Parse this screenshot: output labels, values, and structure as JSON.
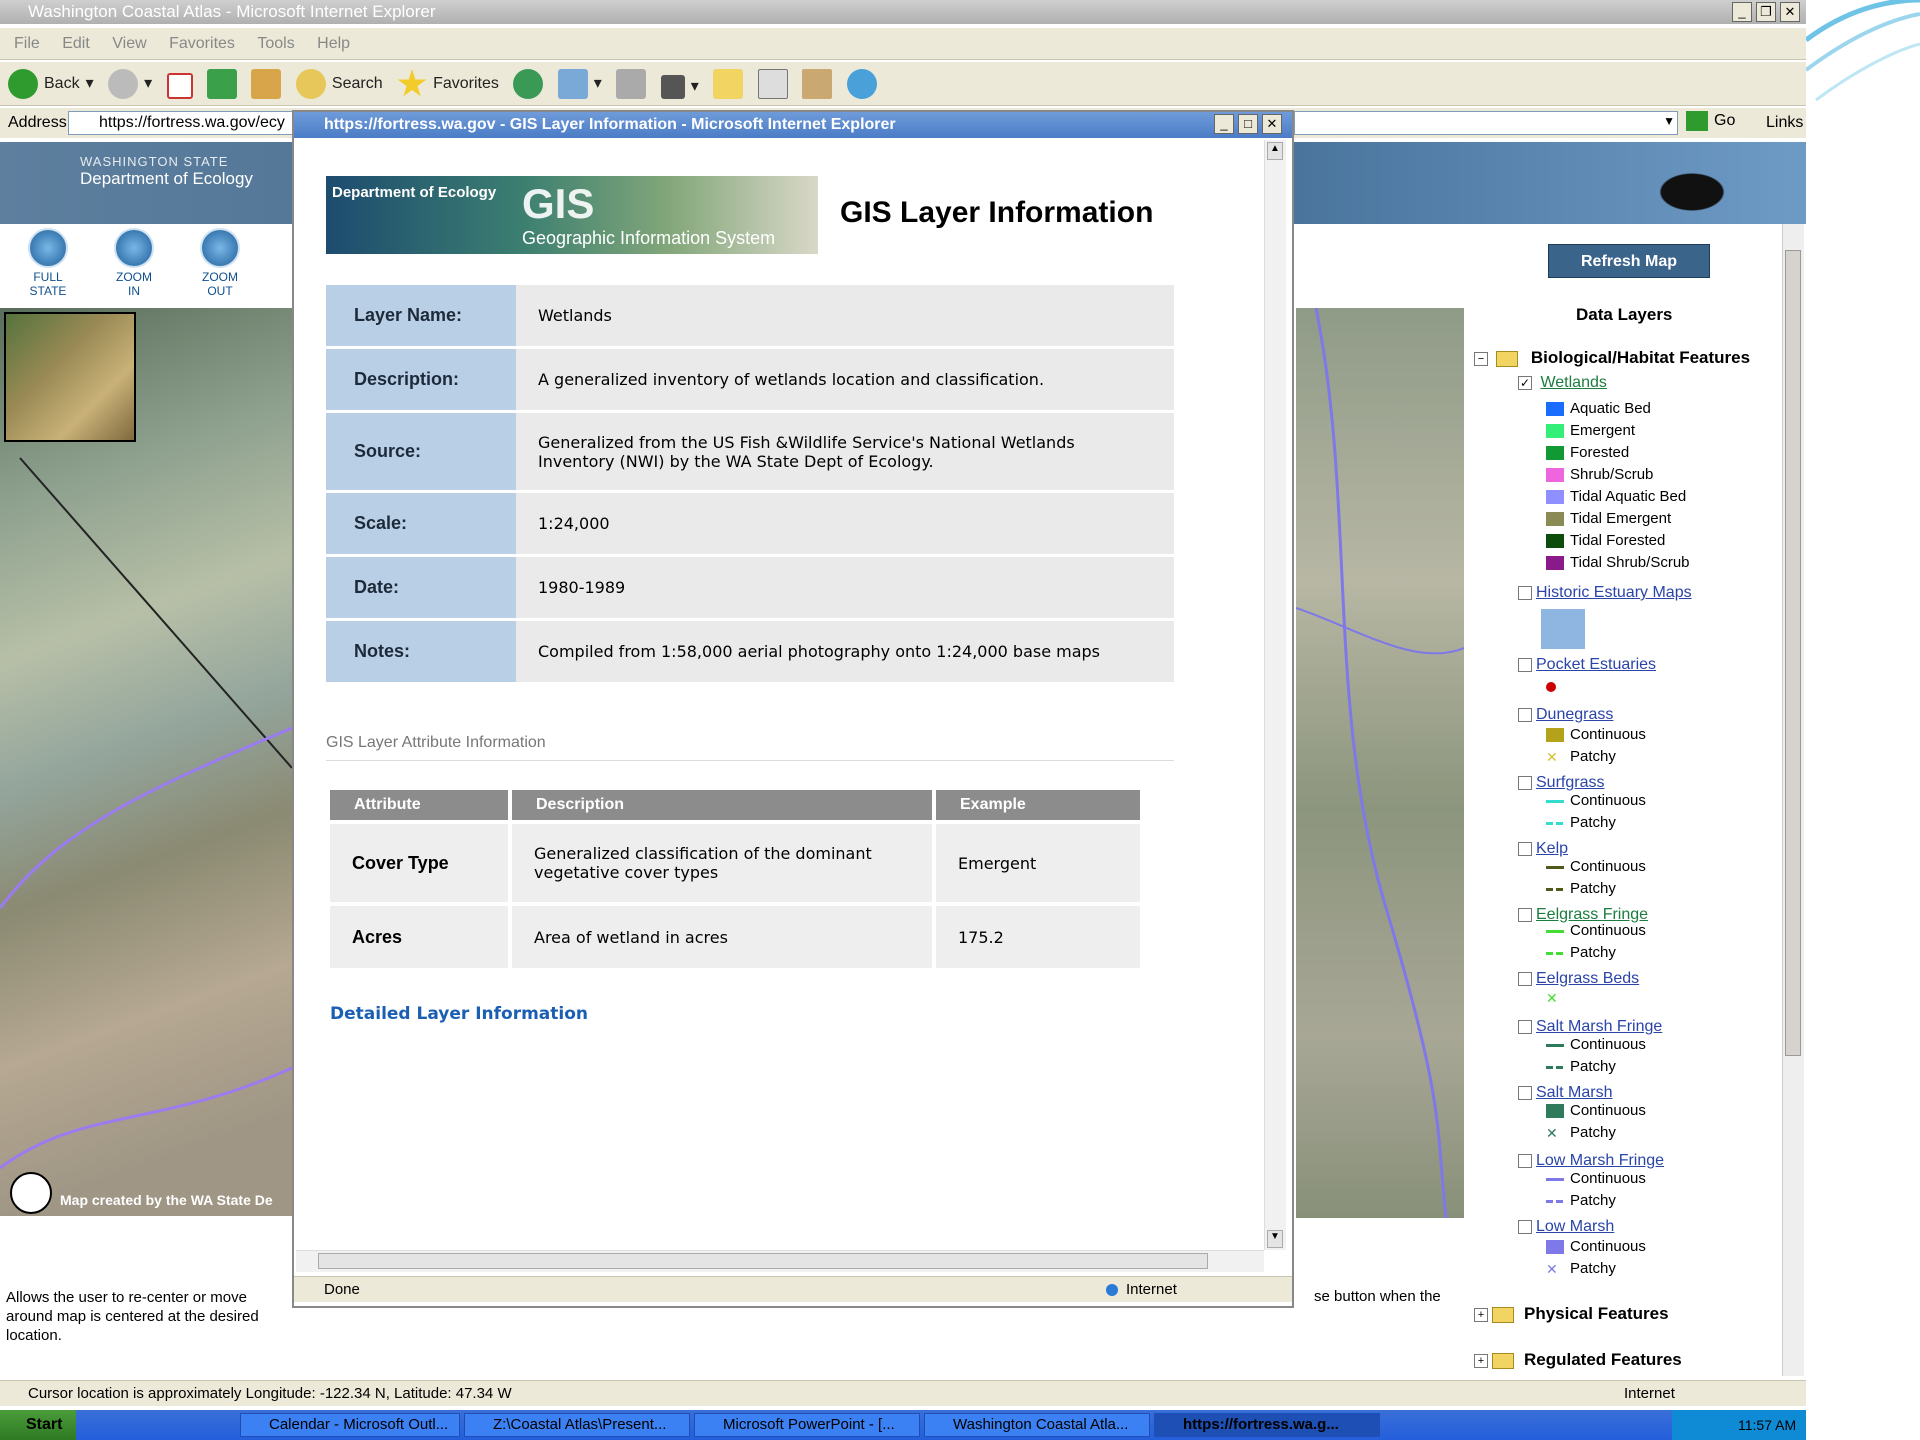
{
  "window": {
    "title": "Washington Coastal Atlas - Microsoft Internet Explorer"
  },
  "menu": [
    "File",
    "Edit",
    "View",
    "Favorites",
    "Tools",
    "Help"
  ],
  "toolbar": {
    "back": "Back",
    "search": "Search",
    "favorites": "Favorites"
  },
  "address": {
    "label": "Address",
    "value": "https://fortress.wa.gov/ecy",
    "go": "Go",
    "links": "Links"
  },
  "agency": {
    "line1": "WASHINGTON STATE",
    "line2": "Department of Ecology"
  },
  "map_tools": [
    {
      "label1": "FULL",
      "label2": "STATE"
    },
    {
      "label1": "ZOOM",
      "label2": "IN"
    },
    {
      "label1": "ZOOM",
      "label2": "OUT"
    }
  ],
  "map_credit": "Map created by the WA State De",
  "help_text_left": "Allows the user to re-center or move around map is centered at the desired location.",
  "help_text_right": "se button when the",
  "popup": {
    "title": "https://fortress.wa.gov - GIS Layer Information - Microsoft Internet Explorer",
    "banner_dept": "Department of Ecology",
    "banner_gis": "GIS",
    "banner_sub": "Geographic Information System",
    "heading": "GIS Layer Information",
    "info": [
      {
        "label": "Layer Name:",
        "value": "Wetlands"
      },
      {
        "label": "Description:",
        "value": "A generalized inventory of wetlands location and classification."
      },
      {
        "label": "Source:",
        "value": "Generalized from the US Fish &Wildlife Service's National Wetlands Inventory (NWI) by the WA State Dept of Ecology."
      },
      {
        "label": "Scale:",
        "value": "1:24,000"
      },
      {
        "label": "Date:",
        "value": "1980-1989"
      },
      {
        "label": "Notes:",
        "value": "Compiled from 1:58,000 aerial photography onto 1:24,000 base maps"
      }
    ],
    "attr_heading": "GIS Layer Attribute Information",
    "attr_columns": [
      "Attribute",
      "Description",
      "Example"
    ],
    "attr_rows": [
      {
        "name": "Cover Type",
        "desc": "Generalized classification of the dominant vegetative cover types",
        "example": "Emergent"
      },
      {
        "name": "Acres",
        "desc": "Area of wetland in acres",
        "example": "175.2"
      }
    ],
    "detail_link": "Detailed Layer Information",
    "status_done": "Done",
    "status_zone": "Internet"
  },
  "right_panel": {
    "refresh": "Refresh Map",
    "heading": "Data Layers",
    "group1": "Biological/Habitat Features",
    "wetlands": "Wetlands",
    "wetland_classes": [
      {
        "name": "Aquatic Bed",
        "color": "#1a6cff"
      },
      {
        "name": "Emergent",
        "color": "#33ee77"
      },
      {
        "name": "Forested",
        "color": "#119933"
      },
      {
        "name": "Shrub/Scrub",
        "color": "#ee66dd"
      },
      {
        "name": "Tidal Aquatic Bed",
        "color": "#8f8fff"
      },
      {
        "name": "Tidal Emergent",
        "color": "#8a8a55"
      },
      {
        "name": "Tidal Forested",
        "color": "#0c4d0c"
      },
      {
        "name": "Tidal Shrub/Scrub",
        "color": "#8a1a8a"
      }
    ],
    "historic": "Historic Estuary Maps",
    "pocket": "Pocket Estuaries",
    "dunegrass": "Dunegrass",
    "surfgrass": "Surfgrass",
    "kelp": "Kelp",
    "eelgrass_fringe": "Eelgrass Fringe",
    "eelgrass_beds": "Eelgrass Beds",
    "salt_marsh_fringe": "Salt Marsh Fringe",
    "salt_marsh": "Salt Marsh",
    "low_marsh_fringe": "Low Marsh Fringe",
    "low_marsh": "Low Marsh",
    "continuous": "Continuous",
    "patchy": "Patchy",
    "group2": "Physical Features",
    "group3": "Regulated Features"
  },
  "statusbar": {
    "cursor": "Cursor location is approximately Longitude: -122.34 N, Latitude: 47.34 W",
    "zone": "Internet"
  },
  "taskbar": {
    "start": "Start",
    "tasks": [
      "Calendar - Microsoft Outl...",
      "Z:\\Coastal Atlas\\Present...",
      "Microsoft PowerPoint - [...",
      "Washington Coastal Atla...",
      "https://fortress.wa.g..."
    ],
    "time": "11:57 AM"
  }
}
